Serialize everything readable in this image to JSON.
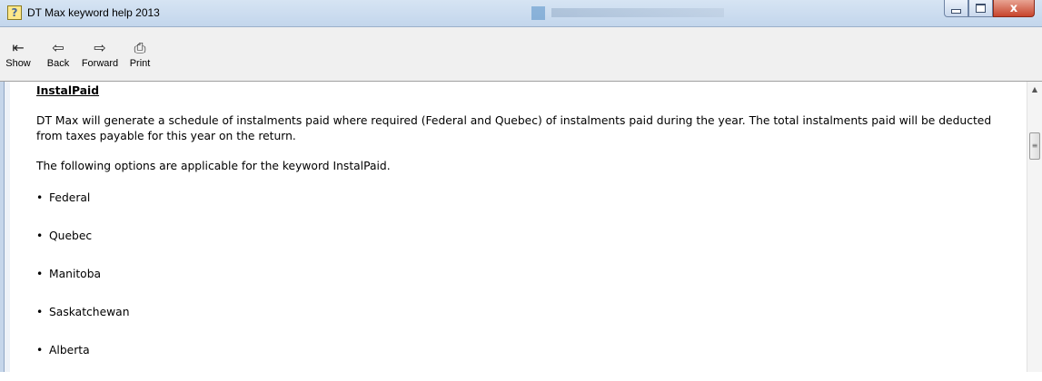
{
  "window": {
    "title": "DT Max keyword help 2013",
    "icon": "help-icon",
    "controls": {
      "minimize": "minimize-icon",
      "maximize": "maximize-icon",
      "close_glyph": "x"
    }
  },
  "toolbar": {
    "buttons": [
      {
        "label": "Show",
        "icon": "show-icon"
      },
      {
        "label": "Back",
        "icon": "back-arrow-icon"
      },
      {
        "label": "Forward",
        "icon": "forward-arrow-icon"
      },
      {
        "label": "Print",
        "icon": "printer-icon"
      }
    ]
  },
  "content": {
    "heading": "InstalPaid",
    "paragraph1": "DT Max will generate a schedule of instalments paid where required (Federal and Quebec) of instalments paid during the year. The total instalments paid will be deducted from taxes payable for this year on the return.",
    "paragraph2": "The following options are applicable for the keyword InstalPaid.",
    "bullet_glyph": "•",
    "options": [
      "Federal",
      "Quebec",
      "Manitoba",
      "Saskatchewan",
      "Alberta"
    ]
  },
  "colors": {
    "titlebar": "#c9daef",
    "close_button": "#c7442c",
    "toolbar": "#f0f0f0"
  }
}
